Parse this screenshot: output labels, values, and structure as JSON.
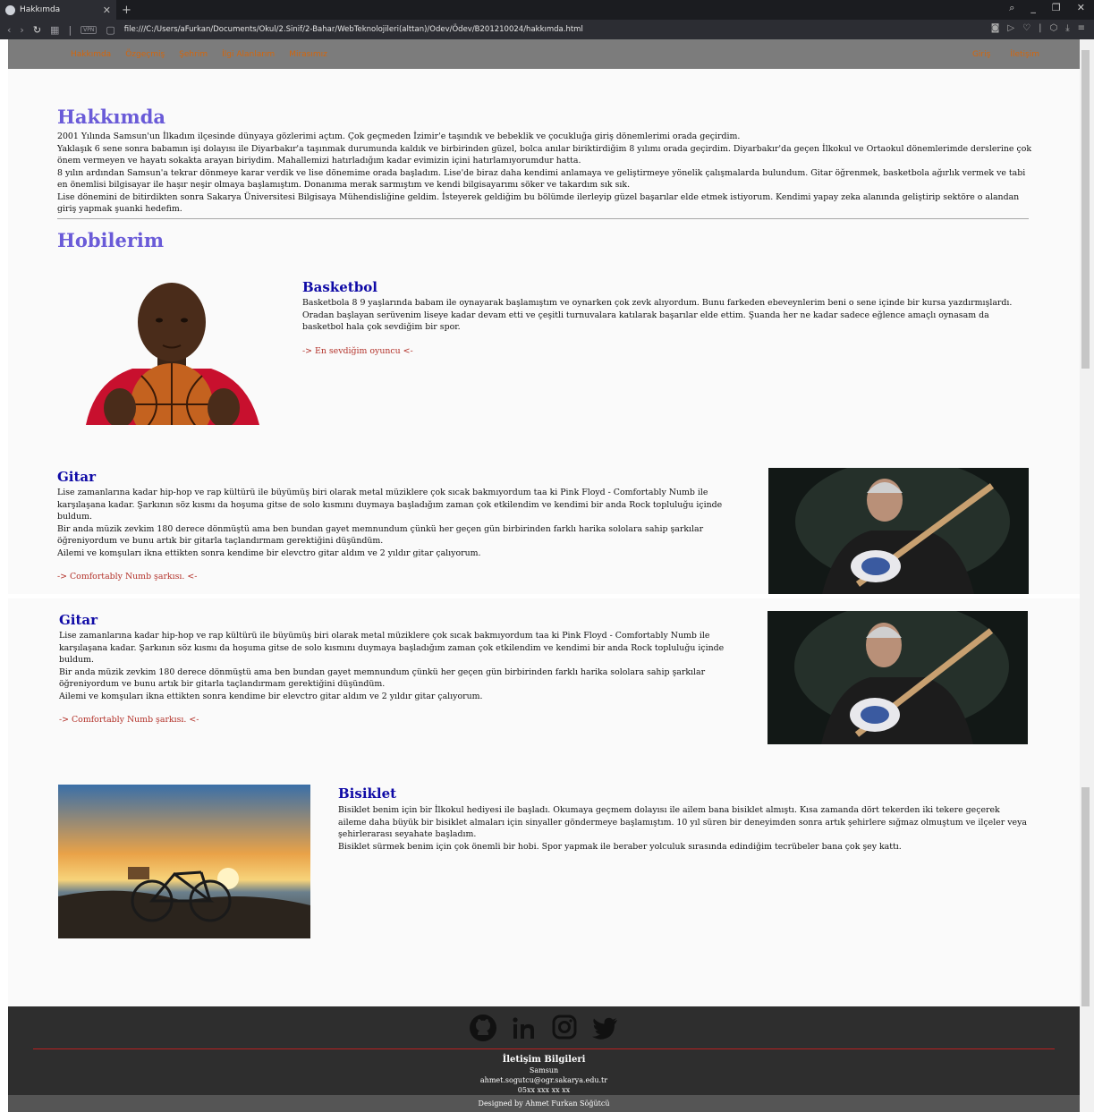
{
  "browser": {
    "tab_title": "Hakkımda",
    "url": "file:///C:/Users/aFurkan/Documents/Okul/2.Sinif/2-Bahar/WebTeknolojileri(alttan)/Odev/Ödev/B201210024/hakkımda.html",
    "vpn_label": "VPN"
  },
  "nav": {
    "left": [
      "Hakkımda",
      "Özgeçmiş",
      "Şehrim",
      "İlgi Alanlarım",
      "Mirasımız"
    ],
    "right": [
      "Giriş",
      "İletişim"
    ]
  },
  "about": {
    "title": "Hakkımda",
    "paragraphs": [
      "2001 Yılında Samsun'un İlkadım ilçesinde dünyaya gözlerimi açtım. Çok geçmeden İzimir'e taşındık ve bebeklik ve çocukluğa giriş dönemlerimi orada geçirdim.",
      "Yaklaşık 6 sene sonra babamın işi dolayısı ile Diyarbakır'a taşınmak durumunda kaldık ve birbirinden güzel, bolca anılar biriktirdiğim 8 yılımı orada geçirdim. Diyarbakır'da geçen İlkokul ve Ortaokul dönemlerimde derslerine çok önem vermeyen ve hayatı sokakta arayan biriydim. Mahallemizi hatırladığım kadar evimizin içini hatırlamıyorumdur hatta.",
      "8 yılın ardından Samsun'a tekrar dönmeye karar verdik ve lise dönemime orada başladım. Lise'de biraz daha kendimi anlamaya ve geliştirmeye yönelik çalışmalarda bulundum. Gitar öğrenmek, basketbola ağırlık vermek ve tabi en önemlisi bilgisayar ile haşır neşir olmaya başlamıştım. Donanıma merak sarmıştım ve kendi bilgisayarımı söker ve takardım sık sık.",
      "Lise dönemini de bitirdikten sonra Sakarya Üniversitesi Bilgisaya Mühendisliğine geldim. İsteyerek geldiğim bu bölümde ilerleyip güzel başarılar elde etmek istiyorum. Kendimi yapay zeka alanında geliştirip sektöre o alandan giriş yapmak şuanki hedefim."
    ]
  },
  "hobbies": {
    "title": "Hobilerim",
    "basketball": {
      "title": "Basketbol",
      "text": "Basketbola 8 9 yaşlarında babam ile oynayarak başlamıştım ve oynarken çok zevk alıyordum. Bunu farkeden ebeveynlerim beni o sene içinde bir kursa yazdırmışlardı. Oradan başlayan serüvenim liseye kadar devam etti ve çeşitli turnuvalara katılarak başarılar elde ettim. Şuanda her ne kadar sadece eğlence amaçlı oynasam da basketbol hala çok sevdiğim bir spor.",
      "link": "-> En sevdiğim oyuncu <-"
    },
    "guitar": {
      "title": "Gitar",
      "paragraphs": [
        "Lise zamanlarına kadar hip-hop ve rap kültürü ile büyümüş biri olarak metal müziklere çok sıcak bakmıyordum taa ki Pink Floyd - Comfortably Numb ile karşılaşana kadar. Şarkının söz kısmı da hoşuma gitse de solo kısmını duymaya başladığım zaman çok etkilendim ve kendimi bir anda Rock topluluğu içinde buldum.",
        "Bir anda müzik zevkim 180 derece dönmüştü ama ben bundan gayet memnundum çünkü her geçen gün birbirinden farklı harika sololara sahip şarkılar öğreniyordum ve bunu artık bir gitarla taçlandırmam gerektiğini düşündüm.",
        "Ailemi ve komşuları ikna ettikten sonra kendime bir elevctro gitar aldım ve 2 yıldır gitar çalıyorum."
      ],
      "link": "-> Comfortably Numb şarkısı. <-"
    },
    "bicycle": {
      "title": "Bisiklet",
      "paragraphs": [
        "Bisiklet benim için bir İlkokul hediyesi ile başladı. Okumaya geçmem dolayısı ile ailem bana bisiklet almıştı. Kısa zamanda dört tekerden iki tekere geçerek aileme daha büyük bir bisiklet almaları için sinyaller göndermeye başlamıştım. 10 yıl süren bir deneyimden sonra artık şehirlere sığmaz olmuştum ve ilçeler veya şehirlerarası seyahate başladım.",
        "Bisiklet sürmek benim için çok önemli bir hobi. Spor yapmak ile beraber yolculuk sırasında edindiğim tecrübeler bana çok şey kattı."
      ]
    }
  },
  "footer": {
    "contact_title": "İletişim Bilgileri",
    "city": "Samsun",
    "email": "ahmet.sogutcu@ogr.sakarya.edu.tr",
    "phone": "05xx xxx xx xx",
    "designed_by": "Designed by Ahmet Furkan Söğütcü"
  }
}
